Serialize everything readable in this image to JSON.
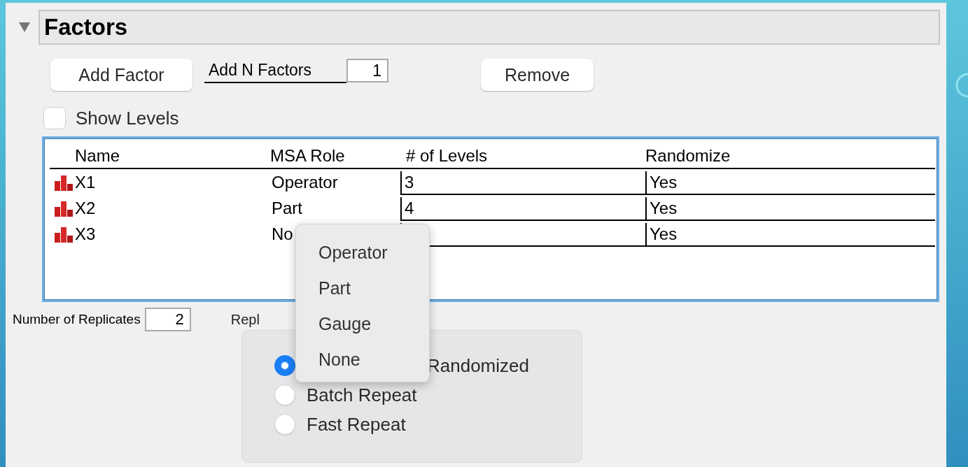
{
  "section": {
    "title": "Factors",
    "expanded": true
  },
  "add_factor_button": "Add Factor",
  "add_n_factors": {
    "label": "Add N Factors",
    "value": "1"
  },
  "remove_button": "Remove",
  "show_levels": {
    "label": "Show Levels",
    "checked": false
  },
  "table": {
    "columns": [
      "Name",
      "MSA Role",
      "# of Levels",
      "Randomize"
    ],
    "rows": [
      {
        "name": "X1",
        "role": "Operator",
        "levels": "3",
        "randomize": "Yes"
      },
      {
        "name": "X2",
        "role": "Part",
        "levels": "4",
        "randomize": "Yes"
      },
      {
        "name": "X3",
        "role": "No",
        "randomize": "Yes"
      }
    ]
  },
  "replicates": {
    "label": "Number of Replicates",
    "value": "2"
  },
  "replicate_group": {
    "label": "Repl",
    "options": [
      {
        "label": "Randomized",
        "selected": true
      },
      {
        "label": "Batch Repeat",
        "selected": false
      },
      {
        "label": "Fast Repeat",
        "selected": false
      }
    ]
  },
  "popup_menu": {
    "items": [
      "Operator",
      "Part",
      "Gauge",
      "None"
    ]
  }
}
